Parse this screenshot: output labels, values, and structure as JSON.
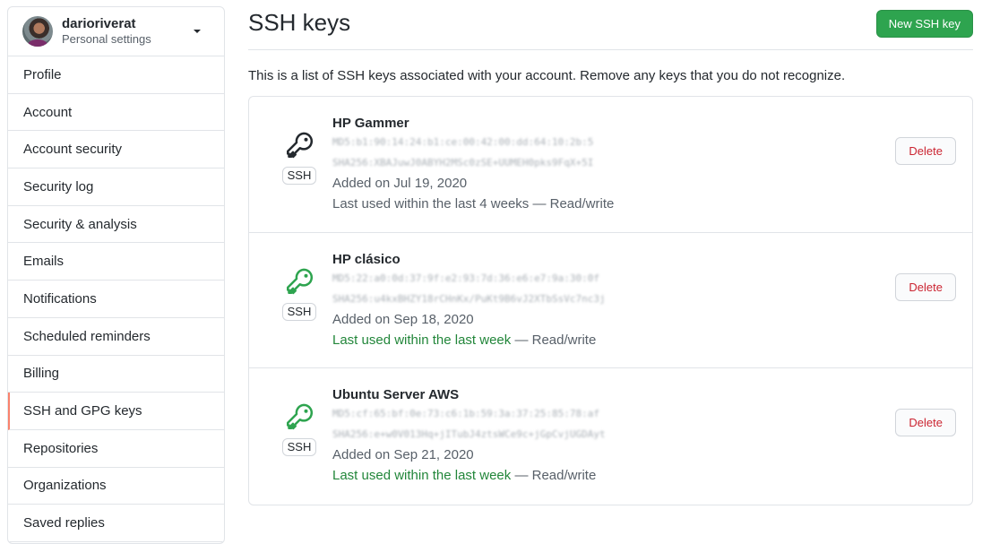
{
  "sidebar": {
    "username": "darioriverat",
    "subtitle": "Personal settings",
    "items": [
      {
        "label": "Profile",
        "active": false
      },
      {
        "label": "Account",
        "active": false
      },
      {
        "label": "Account security",
        "active": false
      },
      {
        "label": "Security log",
        "active": false
      },
      {
        "label": "Security & analysis",
        "active": false
      },
      {
        "label": "Emails",
        "active": false
      },
      {
        "label": "Notifications",
        "active": false
      },
      {
        "label": "Scheduled reminders",
        "active": false
      },
      {
        "label": "Billing",
        "active": false
      },
      {
        "label": "SSH and GPG keys",
        "active": true
      },
      {
        "label": "Repositories",
        "active": false
      },
      {
        "label": "Organizations",
        "active": false
      },
      {
        "label": "Saved replies",
        "active": false
      }
    ]
  },
  "main": {
    "title": "SSH keys",
    "new_key_button": "New SSH key",
    "intro": "This is a list of SSH keys associated with your account. Remove any keys that you do not recognize.",
    "keys": [
      {
        "name": "HP Gammer",
        "md5": "MD5:b1:90:14:24:b1:ce:00:42:00:dd:64:10:2b:5",
        "sha256": "SHA256:XBAJuwJ0ABYH2MSc0zSE+UUMEH0pks9FqX+5I",
        "badge": "SSH",
        "added": "Added on Jul 19, 2020",
        "last_used": "Last used within the last 4 weeks",
        "recent": false,
        "access": " — Read/write",
        "delete_label": "Delete"
      },
      {
        "name": "HP clásico",
        "md5": "MD5:22:a0:0d:37:9f:e2:93:7d:36:e6:e7:9a:30:0f",
        "sha256": "SHA256:u4kxBHZY18rCHnKx/PuKt9B6vJ2XTbSsVc7nc3j",
        "badge": "SSH",
        "added": "Added on Sep 18, 2020",
        "last_used": "Last used within the last week",
        "recent": true,
        "access": " — Read/write",
        "delete_label": "Delete"
      },
      {
        "name": "Ubuntu Server AWS",
        "md5": "MD5:cf:65:bf:0e:73:c6:1b:59:3a:37:25:85:78:af",
        "sha256": "SHA256:e+w0V013Hq+jITubJ4ztsWCe9c+jGpCvjUGDAyt",
        "badge": "SSH",
        "added": "Added on Sep 21, 2020",
        "last_used": "Last used within the last week",
        "recent": true,
        "access": " — Read/write",
        "delete_label": "Delete"
      }
    ]
  },
  "colors": {
    "key_recent": "#2ea44f",
    "key_stale": "#24292e",
    "primary_button": "#2ea44f",
    "danger_text": "#cb2431",
    "active_nav_border": "#f9826c",
    "recent_text": "#22863a"
  }
}
